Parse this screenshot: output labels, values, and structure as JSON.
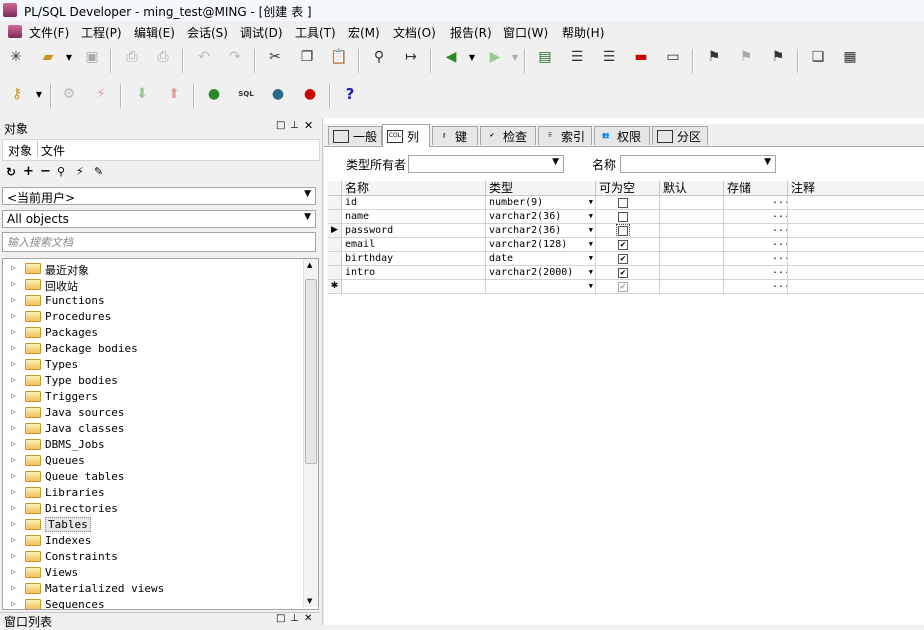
{
  "window": {
    "title": "PL/SQL Developer - ming_test@MING - [创建 表 ]"
  },
  "menubar": [
    "文件(F)",
    "工程(P)",
    "编辑(E)",
    "会话(S)",
    "调试(D)",
    "工具(T)",
    "宏(M)",
    "文档(O)",
    "报告(R)",
    "窗口(W)",
    "帮助(H)"
  ],
  "toolbar2": {
    "help_glyph": "?",
    "sql_badge": "SQL"
  },
  "left_panel": {
    "title": "对象",
    "tabs": [
      "对象",
      "文件"
    ],
    "user_combo": "<当前用户>",
    "filter_combo": "All objects",
    "search_placeholder": "输入搜索文档",
    "tree": [
      {
        "label": "最近对象"
      },
      {
        "label": "回收站"
      },
      {
        "label": "Functions"
      },
      {
        "label": "Procedures"
      },
      {
        "label": "Packages"
      },
      {
        "label": "Package bodies"
      },
      {
        "label": "Types"
      },
      {
        "label": "Type bodies"
      },
      {
        "label": "Triggers"
      },
      {
        "label": "Java sources"
      },
      {
        "label": "Java classes"
      },
      {
        "label": "DBMS_Jobs"
      },
      {
        "label": "Queues"
      },
      {
        "label": "Queue tables"
      },
      {
        "label": "Libraries"
      },
      {
        "label": "Directories"
      },
      {
        "label": "Tables",
        "selected": true
      },
      {
        "label": "Indexes"
      },
      {
        "label": "Constraints"
      },
      {
        "label": "Views"
      },
      {
        "label": "Materialized views"
      },
      {
        "label": "Sequences"
      }
    ],
    "bottom_title": "窗口列表"
  },
  "editor": {
    "tabs": [
      {
        "label": "一般",
        "icon": "general-icon"
      },
      {
        "label": "列",
        "icon": "columns-icon",
        "badge": "COL",
        "active": true
      },
      {
        "label": "键",
        "icon": "key-icon"
      },
      {
        "label": "检查",
        "icon": "check-icon"
      },
      {
        "label": "索引",
        "icon": "index-icon"
      },
      {
        "label": "权限",
        "icon": "privileges-icon"
      },
      {
        "label": "分区",
        "icon": "partition-icon"
      }
    ],
    "owner_label": "类型所有者",
    "owner_value": "",
    "name_label": "名称",
    "name_value": "",
    "grid": {
      "headers": [
        "名称",
        "类型",
        "可为空",
        "默认",
        "存储",
        "注释"
      ],
      "rows": [
        {
          "name": "id",
          "type": "number(9)",
          "nullable": false,
          "ellipsis": "..."
        },
        {
          "name": "name",
          "type": "varchar2(36)",
          "nullable": false,
          "ellipsis": "..."
        },
        {
          "name": "password",
          "type": "varchar2(36)",
          "nullable": false,
          "ellipsis": "...",
          "current": true
        },
        {
          "name": "email",
          "type": "varchar2(128)",
          "nullable": true,
          "ellipsis": "..."
        },
        {
          "name": "birthday",
          "type": "date",
          "nullable": true,
          "ellipsis": "..."
        },
        {
          "name": "intro",
          "type": "varchar2(2000)",
          "nullable": true,
          "ellipsis": "..."
        },
        {
          "name": "",
          "type": "",
          "nullable": true,
          "ellipsis": "...",
          "new": true
        }
      ]
    }
  }
}
